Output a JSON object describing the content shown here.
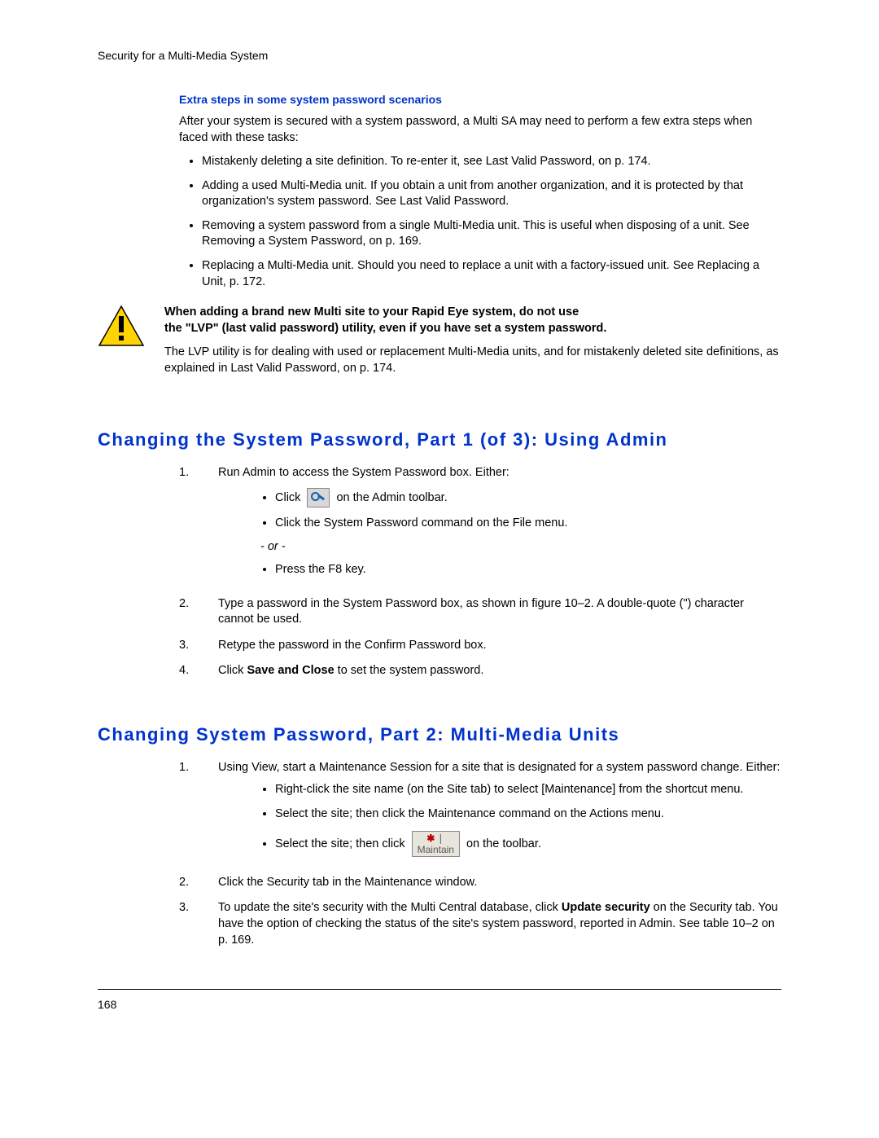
{
  "header": {
    "running": "Security for a Multi-Media System"
  },
  "section1": {
    "subhead": "Extra steps in some system password scenarios",
    "intro": "After your system is secured with a system password, a Multi SA may need to perform a few extra steps when faced with these tasks:",
    "bullets": [
      "Mistakenly deleting a site definition. To re-enter it, see Last Valid Password, on p. 174.",
      "Adding a used Multi-Media unit. If you obtain a unit from another organization, and it is protected by that organization's system password. See Last Valid Password.",
      "Removing a system password from a single Multi-Media unit. This is useful when disposing of a unit. See  Removing a System Password, on p. 169.",
      "Replacing a Multi-Media unit. Should you need to replace a unit with a factory-issued unit. See Replacing a Unit, p. 172."
    ]
  },
  "warning": {
    "bold1": "When adding a brand new Multi site to your Rapid Eye system, do not use",
    "bold2": "the \"LVP\" (last valid password) utility, even if you have set a system password.",
    "text": "The LVP utility is for dealing with used or replacement Multi-Media units, and for mistakenly deleted site definitions, as explained in Last Valid Password, on p. 174."
  },
  "part1": {
    "heading": "Changing the System Password, Part 1 (of 3): Using Admin",
    "step1": "Run Admin to access the System Password box. Either:",
    "step1_sub_a_pre": "Click ",
    "step1_sub_a_post": " on the Admin toolbar.",
    "step1_sub_b": "Click the System Password command on the File menu.",
    "step1_or": "- or -",
    "step1_sub_c": "Press the F8 key.",
    "step2": "Type a password in the System Password box, as shown in figure 10–2. A double-quote (\") character cannot be used.",
    "step3": "Retype the password in the Confirm Password box.",
    "step4_pre": "Click ",
    "step4_bold": "Save and Close",
    "step4_post": " to set the system password."
  },
  "part2": {
    "heading": "Changing System Password, Part 2: Multi-Media Units",
    "step1": "Using View, start a Maintenance Session for a site that is designated for a system password change. Either:",
    "step1_sub_a": "Right-click the site name (on the Site tab) to select [Maintenance] from the shortcut menu.",
    "step1_sub_b": "Select the site; then click the Maintenance command on the Actions menu.",
    "step1_sub_c_pre": "Select the site; then click ",
    "step1_sub_c_post": " on the toolbar.",
    "maintain_label": "Maintain",
    "step2": "Click the Security tab in the Maintenance window.",
    "step3_pre": "To update the site's security with the Multi Central database, click ",
    "step3_bold": "Update security",
    "step3_post": " on the Security tab. You have the option of checking the status of the site's system password, reported in Admin. See table 10–2 on p. 169."
  },
  "footer": {
    "page": "168"
  }
}
